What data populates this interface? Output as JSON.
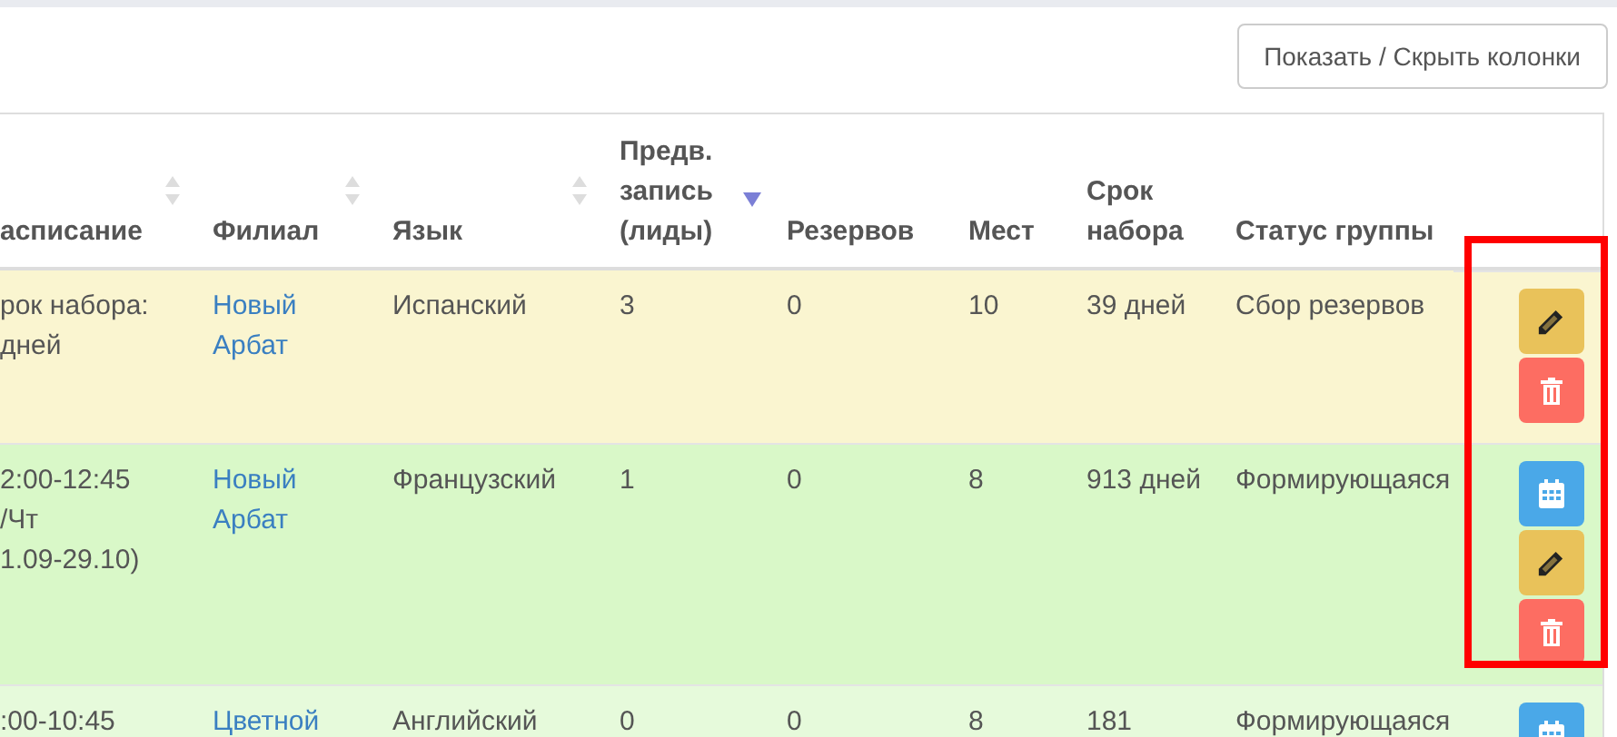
{
  "toolbar": {
    "columns_button": "Показать / Скрыть колонки"
  },
  "table": {
    "columns": [
      {
        "label": "асписание",
        "sortable": true,
        "sorted": false
      },
      {
        "label": "Филиал",
        "sortable": true,
        "sorted": false
      },
      {
        "label": "Язык",
        "sortable": true,
        "sorted": false
      },
      {
        "label": "Предв. запись (лиды)",
        "sortable": true,
        "sorted": true
      },
      {
        "label": "Резервов",
        "sortable": false,
        "sorted": false
      },
      {
        "label": "Мест",
        "sortable": false,
        "sorted": false
      },
      {
        "label": "Срок набора",
        "sortable": false,
        "sorted": false
      },
      {
        "label": "Статус группы",
        "sortable": false,
        "sorted": false
      }
    ],
    "rows": [
      {
        "color": "#faf5d0",
        "highlighted": true,
        "schedule": [
          "рок набора:",
          "дней"
        ],
        "branch": "Новый Арбат",
        "language": "Испанский",
        "leads": "3",
        "reserves": "0",
        "seats": "10",
        "term": "39 дней",
        "status": "Сбор резервов",
        "actions": [
          {
            "kind": "edit"
          },
          {
            "kind": "delete"
          }
        ]
      },
      {
        "color": "#d9f8c8",
        "highlighted": true,
        "schedule": [
          "2:00-12:45",
          "/Чт",
          "1.09-29.10)"
        ],
        "branch": "Новый Арбат",
        "language": "Французский",
        "leads": "1",
        "reserves": "0",
        "seats": "8",
        "term": "913 дней",
        "status": "Формирующаяся",
        "actions": [
          {
            "kind": "calendar"
          },
          {
            "kind": "edit"
          },
          {
            "kind": "delete"
          }
        ]
      },
      {
        "color": "#e6fadb",
        "highlighted": false,
        "schedule": [
          ":00-10:45"
        ],
        "branch": "Цветной",
        "language": "Английский",
        "leads": "0",
        "reserves": "0",
        "seats": "8",
        "term": "181",
        "status": "Формирующаяся",
        "actions": [
          {
            "kind": "calendar"
          }
        ]
      }
    ]
  }
}
